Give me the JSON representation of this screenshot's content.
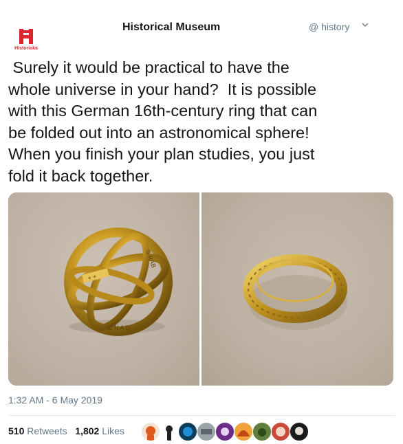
{
  "header": {
    "account_name": "Historical Museum",
    "handle": "@ history",
    "logo_text": "Historiska",
    "caret_icon": "chevron-down-icon"
  },
  "tweet": {
    "text": " Surely it would be practical to have the\nwhole universe in your hand?  It is possible\nwith this German 16th-century ring that can\nbe folded out into an astronomical sphere!\nWhen you finish your plan studies, you just\nfold it back together.",
    "timestamp": "1:32 AM - 6 May 2019"
  },
  "media": {
    "photos": [
      {
        "subject": "gold armillary sphere ring unfolded"
      },
      {
        "subject": "gold ring folded"
      }
    ]
  },
  "stats": {
    "retweets_count": "510",
    "retweets_label": "Retweets",
    "likes_count": "1,802",
    "likes_label": "Likes"
  },
  "colors": {
    "brand_red": "#e0242d",
    "text_primary": "#14171a",
    "text_secondary": "#657786",
    "gold": "#c9a227"
  }
}
